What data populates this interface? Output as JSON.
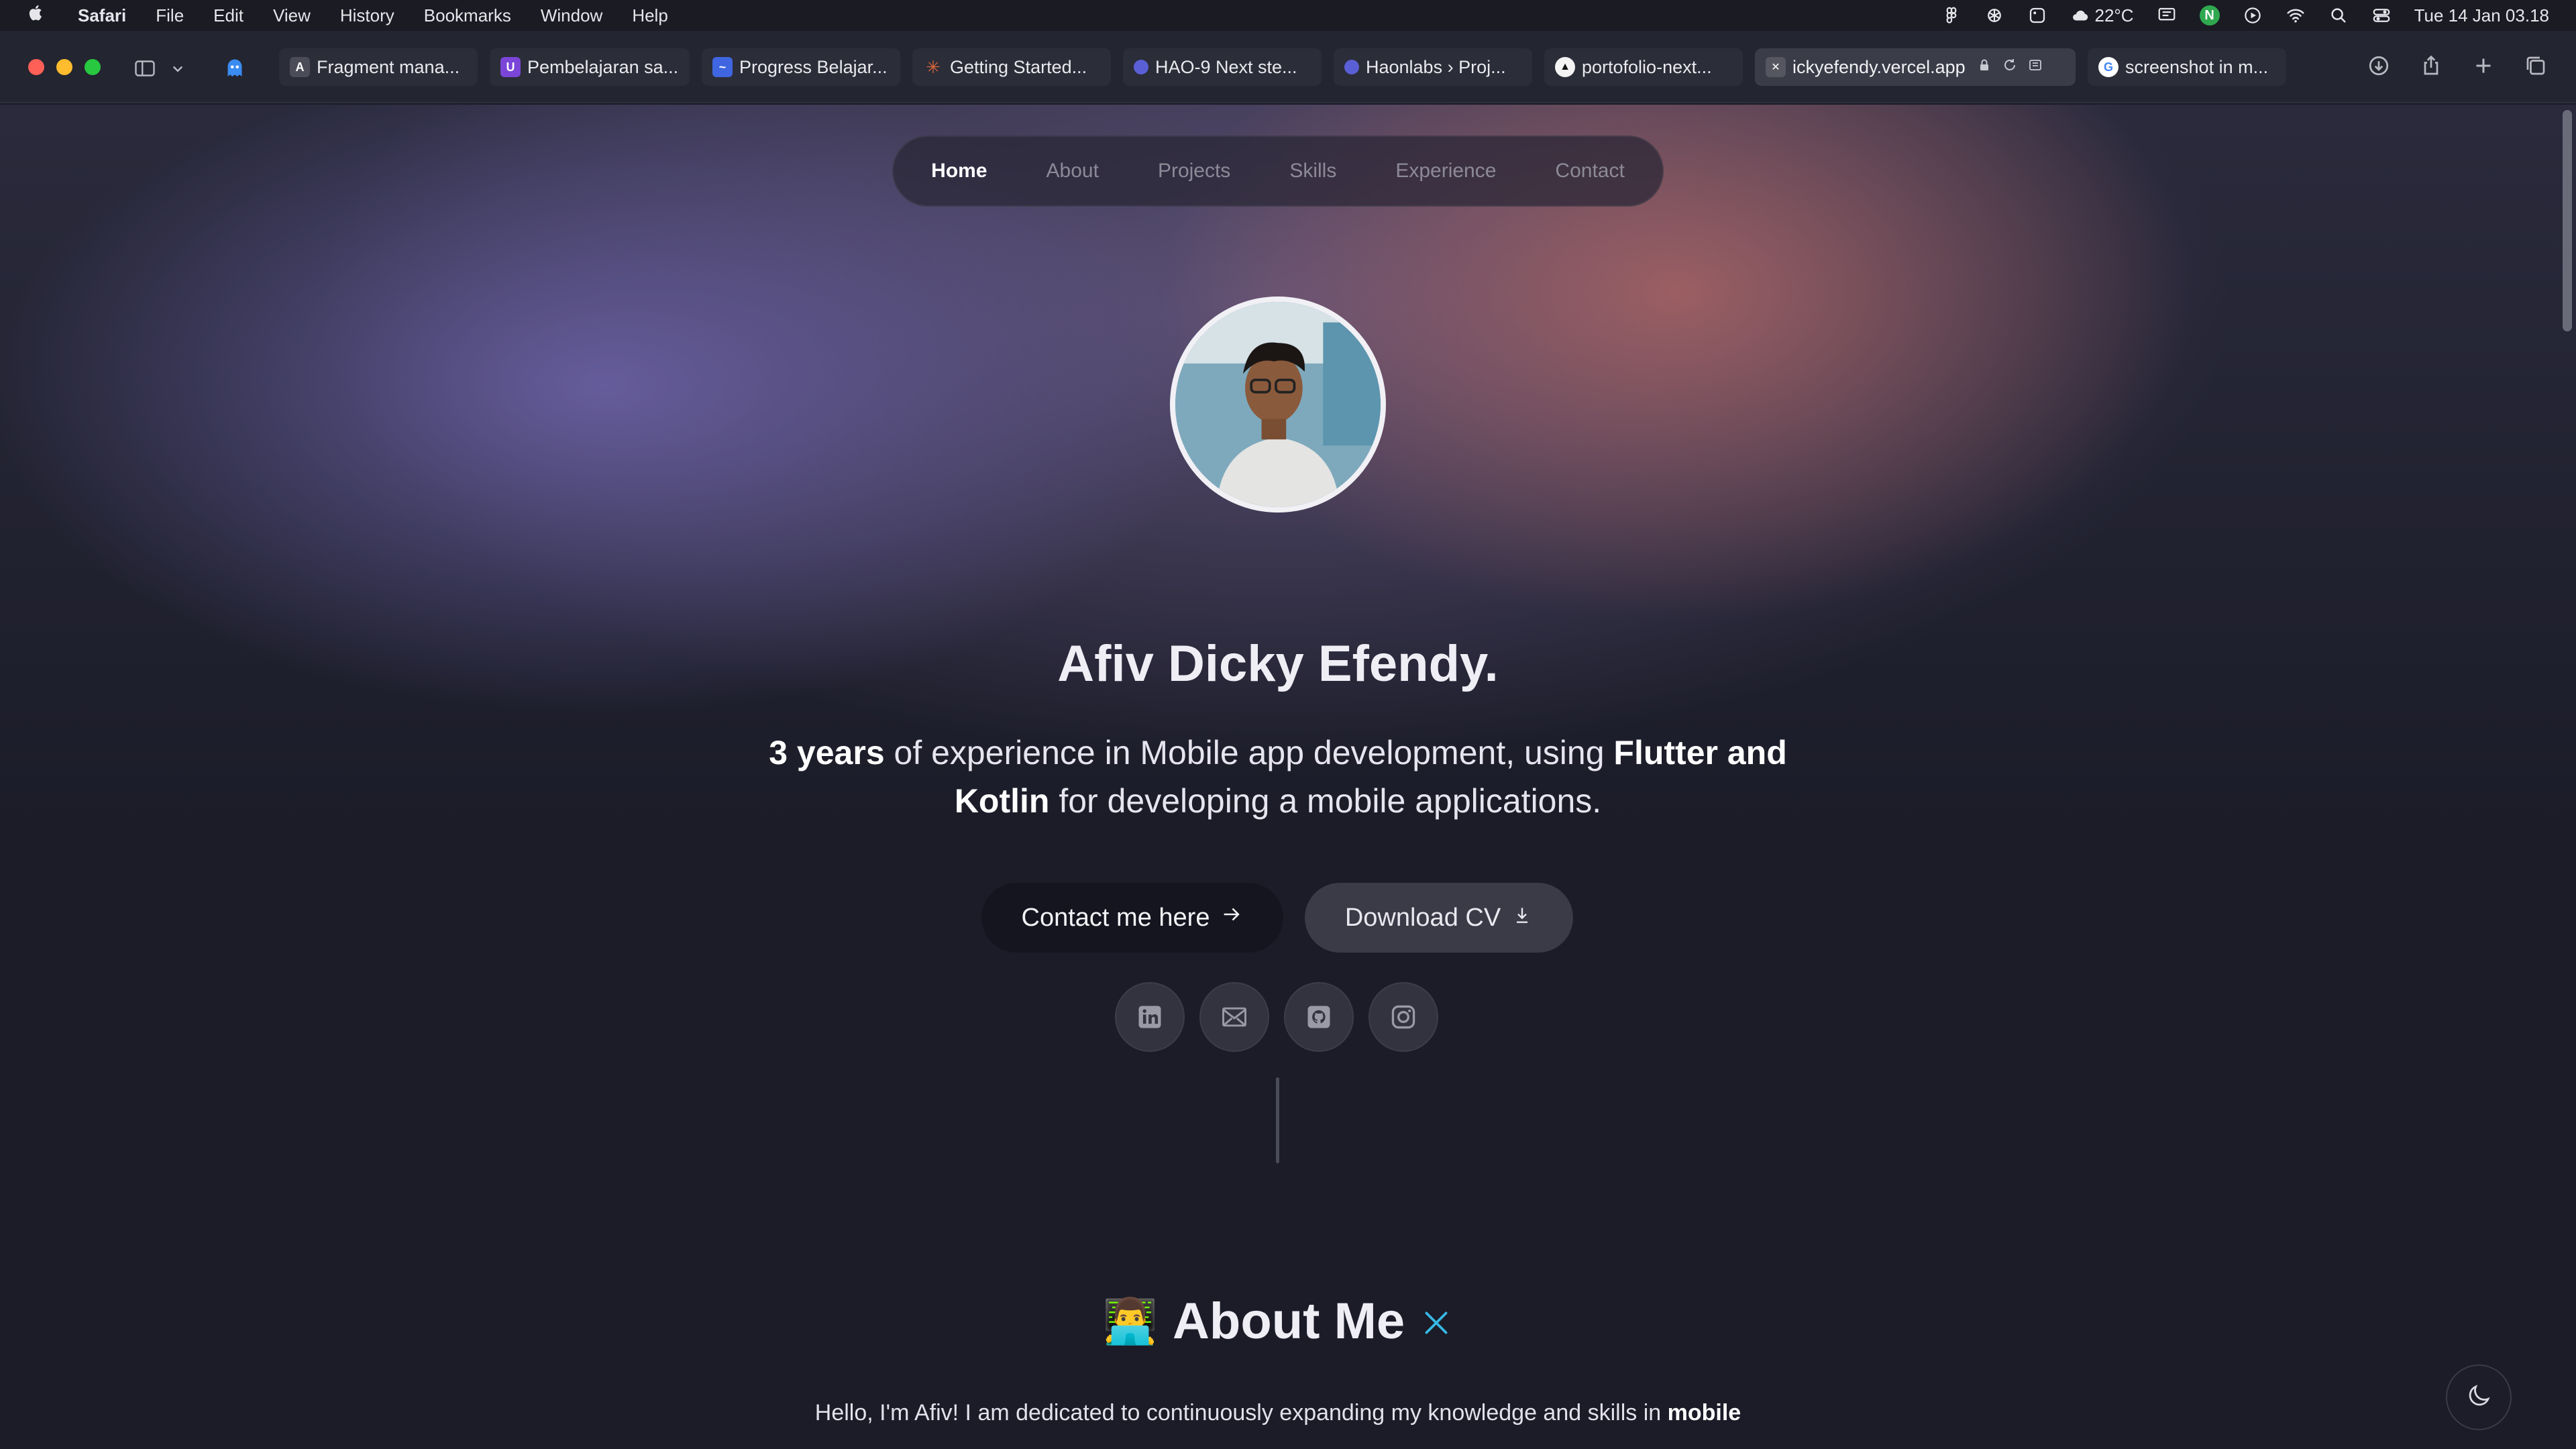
{
  "menubar": {
    "app_name": "Safari",
    "items": [
      "File",
      "Edit",
      "View",
      "History",
      "Bookmarks",
      "Window",
      "Help"
    ],
    "weather": "22°C",
    "datetime": "Tue 14 Jan  03.18",
    "n_badge": "N"
  },
  "toolbar": {
    "tabs": [
      {
        "label": "Fragment mana...",
        "favicon": "A",
        "color": "#3a3a46"
      },
      {
        "label": "Pembelajaran sa...",
        "favicon": "U",
        "color": "#7b45d8"
      },
      {
        "label": "Progress Belajar...",
        "favicon": "~",
        "color": "#3f66e0"
      },
      {
        "label": "Getting Started...",
        "favicon": "✳",
        "color": "#d8663a"
      },
      {
        "label": "HAO-9 Next ste...",
        "favicon": "◐",
        "color": "#5b5fd6"
      },
      {
        "label": "Haonlabs › Proj...",
        "favicon": "◐",
        "color": "#5b5fd6"
      },
      {
        "label": "portofolio-next...",
        "favicon": "▲",
        "color": "#111111"
      },
      {
        "label": "ickyefendy.vercel.app",
        "favicon": "✕",
        "color": "#55565f",
        "active": true
      },
      {
        "label": "screenshot in m...",
        "favicon": "G",
        "color": "#ffffff"
      }
    ]
  },
  "nav": {
    "items": [
      "Home",
      "About",
      "Projects",
      "Skills",
      "Experience",
      "Contact"
    ],
    "active": "Home"
  },
  "hero": {
    "name": "Afiv Dicky Efendy.",
    "desc_bold1": "3 years",
    "desc_text1": " of experience in Mobile app development, using ",
    "desc_bold2": "Flutter and Kotlin",
    "desc_text2": " for developing a mobile applications.",
    "contact_button": "Contact me here",
    "download_button": "Download CV"
  },
  "social": [
    "linkedin-icon",
    "mail-icon",
    "github-icon",
    "instagram-icon"
  ],
  "about": {
    "emoji": "👨‍💻",
    "title": "About Me",
    "text_start": "Hello, I'm Afiv! I am dedicated to continuously expanding my knowledge and skills in ",
    "text_bold": "mobile"
  },
  "colors": {
    "accent_sparkle": "#38b8e4",
    "page_bg": "#1b1c28"
  }
}
